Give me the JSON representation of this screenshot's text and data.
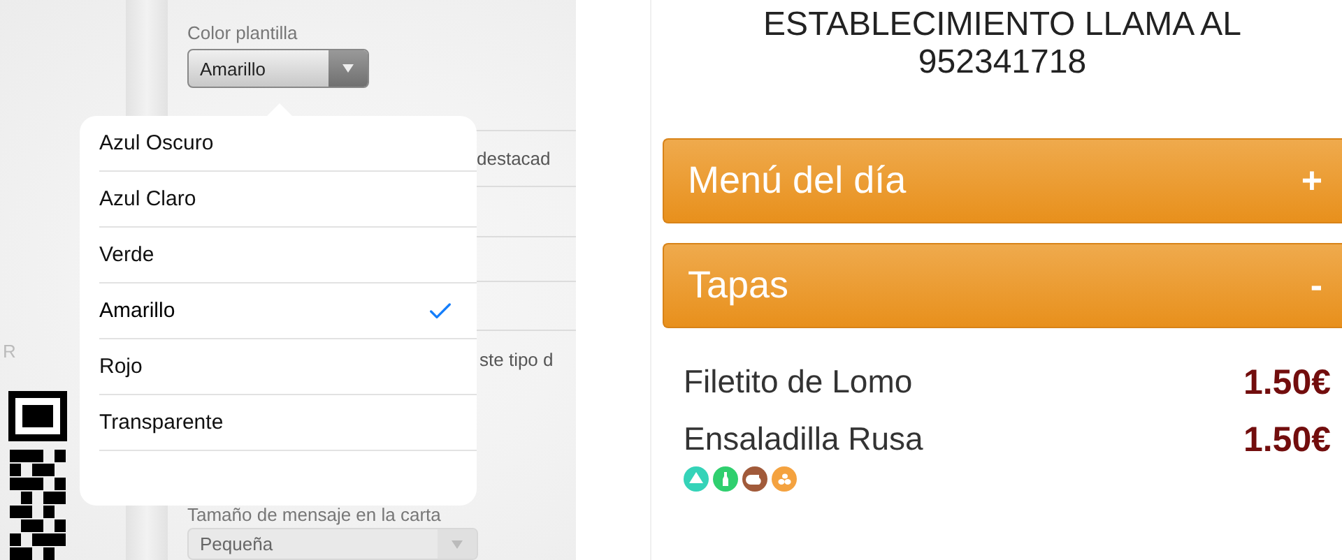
{
  "settings": {
    "side_label": "R",
    "template_color": {
      "label": "Color plantilla",
      "value": "Amarillo"
    },
    "picker": {
      "options": [
        {
          "label": "Azul Oscuro",
          "selected": false
        },
        {
          "label": "Azul Claro",
          "selected": false
        },
        {
          "label": "Verde",
          "selected": false
        },
        {
          "label": "Amarillo",
          "selected": true
        },
        {
          "label": "Rojo",
          "selected": false
        },
        {
          "label": "Transparente",
          "selected": false
        }
      ]
    },
    "hidden_texts": [
      "destacad",
      "ste tipo d"
    ],
    "message_size": {
      "label": "Tamaño de mensaje en la carta",
      "value": "Pequeña"
    }
  },
  "menu_preview": {
    "notice": [
      "ESTABLECIMIENTO LLAMA AL",
      "952341718"
    ],
    "sections": [
      {
        "title": "Menú del día",
        "sign": "+"
      },
      {
        "title": "Tapas",
        "sign": "-",
        "items": [
          {
            "name": "Filetito de Lomo",
            "price": "1.50€"
          },
          {
            "name": "Ensaladilla Rusa",
            "price": "1.50€",
            "allergens": [
              {
                "kind": "shell",
                "color": "#34d3b8"
              },
              {
                "kind": "bottle",
                "color": "#2fcf6e"
              },
              {
                "kind": "jug",
                "color": "#a15a3a"
              },
              {
                "kind": "eggs",
                "color": "#f4a23f"
              }
            ]
          }
        ]
      }
    ]
  }
}
